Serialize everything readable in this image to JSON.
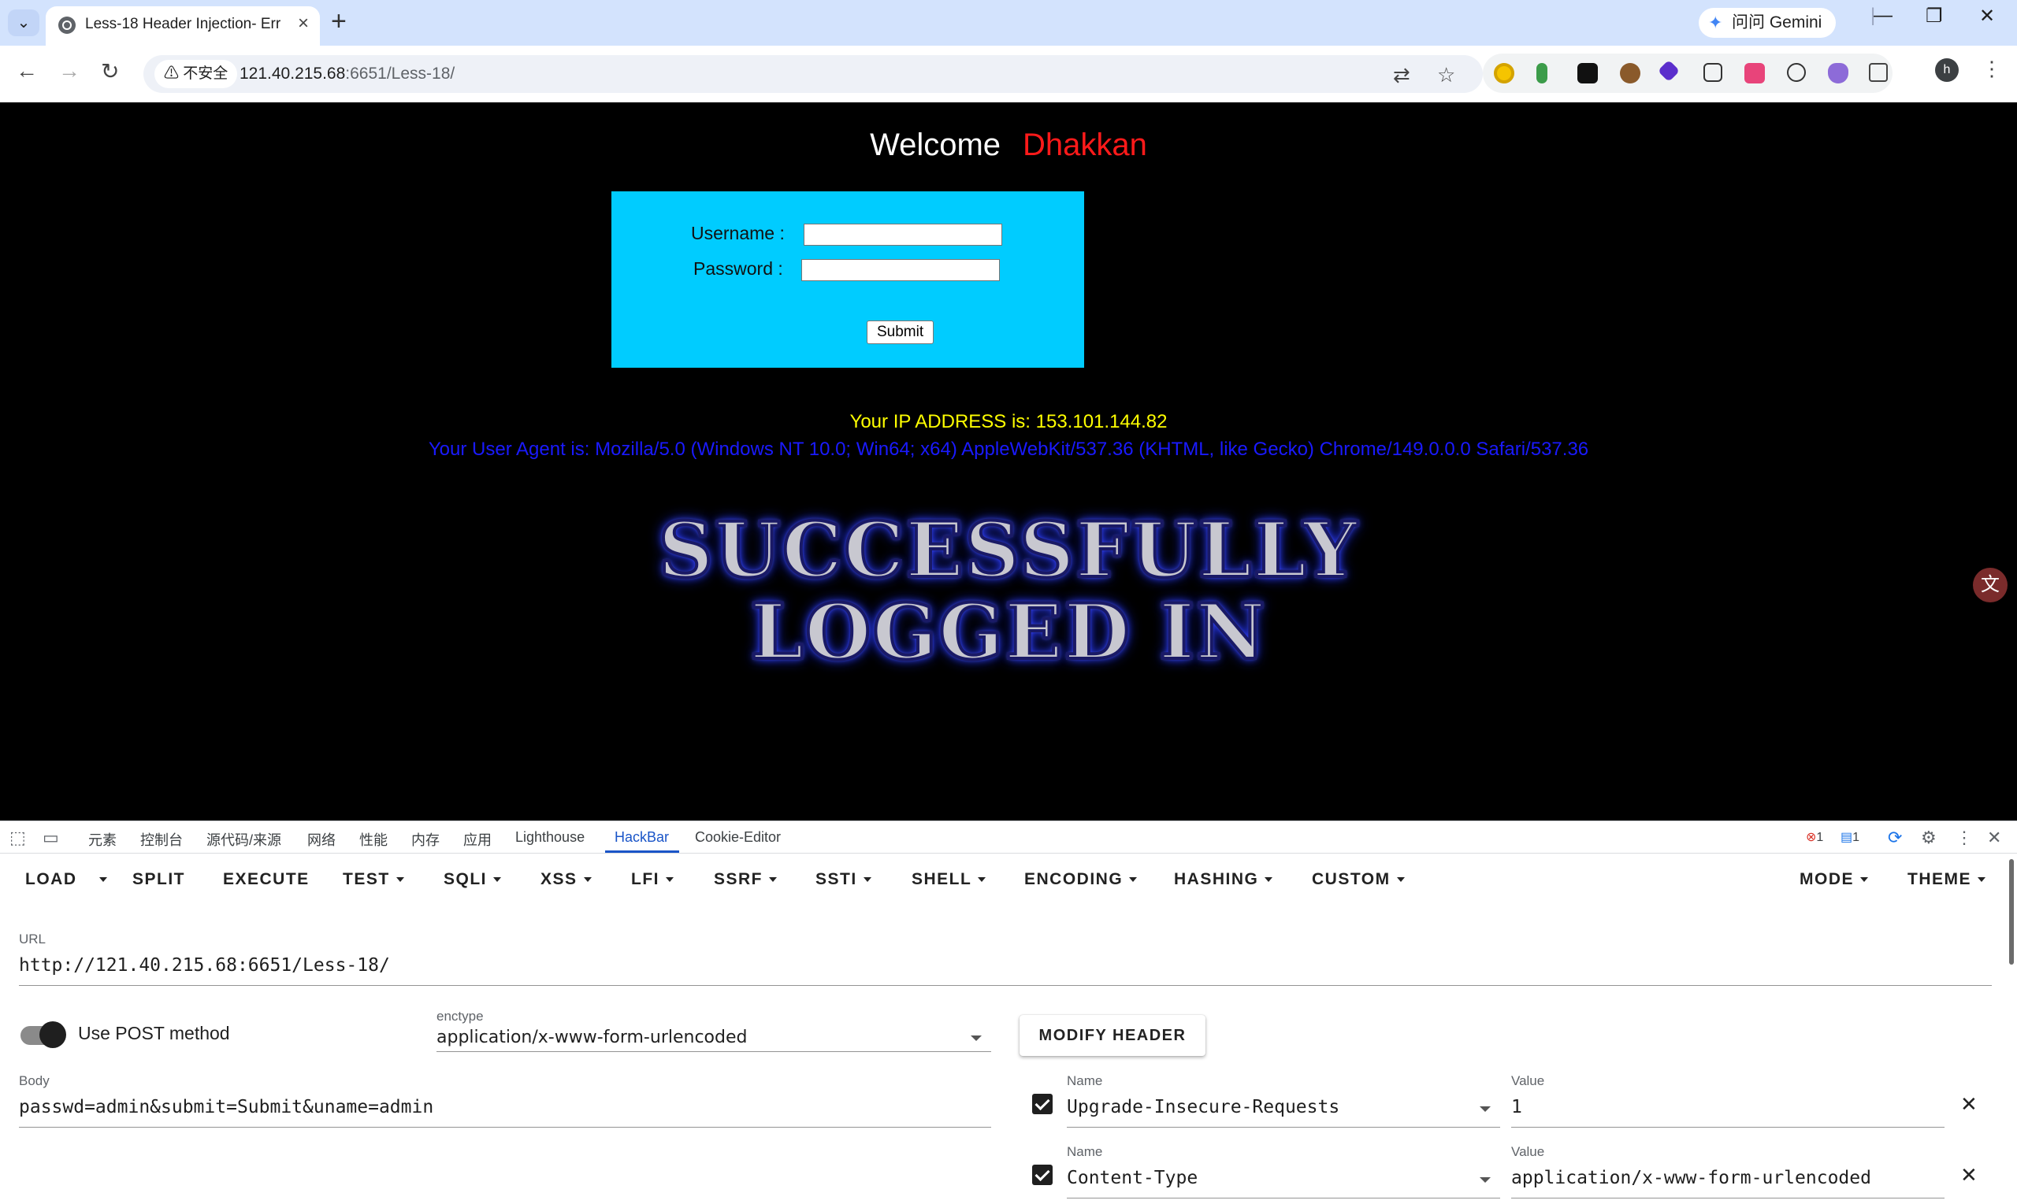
{
  "browser": {
    "tab_title": "Less-18 Header Injection- Err",
    "new_tab": "+",
    "gemini_label": "问问 Gemini",
    "insecure_label": "不安全",
    "url_host": "121.40.215.68",
    "url_rest": ":6651/Less-18/",
    "profile_initial": "h"
  },
  "page": {
    "welcome": "Welcome",
    "user": "Dhakkan",
    "username_label": "Username :",
    "password_label": "Password :",
    "submit_label": "Submit",
    "ip_line": "Your IP ADDRESS is: 153.101.144.82",
    "ua_line": "Your User Agent is: Mozilla/5.0 (Windows NT 10.0; Win64; x64) AppleWebKit/537.36 (KHTML, like Gecko) Chrome/149.0.0.0 Safari/537.36",
    "success_line1": "SUCCESSFULLY",
    "success_line2": "LOGGED IN"
  },
  "devtools": {
    "tabs": [
      "元素",
      "控制台",
      "源代码/来源",
      "网络",
      "性能",
      "内存",
      "应用",
      "Lighthouse",
      "HackBar",
      "Cookie-Editor"
    ],
    "active_tab": "HackBar",
    "error_count": "1",
    "message_count": "1"
  },
  "hackbar": {
    "menu": {
      "load": "LOAD",
      "split": "SPLIT",
      "execute": "EXECUTE",
      "test": "TEST",
      "sqli": "SQLI",
      "xss": "XSS",
      "lfi": "LFI",
      "ssrf": "SSRF",
      "ssti": "SSTI",
      "shell": "SHELL",
      "encoding": "ENCODING",
      "hashing": "HASHING",
      "custom": "CUSTOM",
      "mode": "MODE",
      "theme": "THEME"
    },
    "url_label": "URL",
    "url_value": "http://121.40.215.68:6651/Less-18/",
    "post_toggle_label": "Use POST method",
    "post_enabled": true,
    "enctype_label": "enctype",
    "enctype_value": "application/x-www-form-urlencoded",
    "modify_header": "MODIFY HEADER",
    "body_label": "Body",
    "body_value": "passwd=admin&submit=Submit&uname=admin",
    "headers": [
      {
        "name_label": "Name",
        "name": "Upgrade-Insecure-Requests",
        "value_label": "Value",
        "value": "1",
        "enabled": true
      },
      {
        "name_label": "Name",
        "name": "Content-Type",
        "value_label": "Value",
        "value": "application/x-www-form-urlencoded",
        "enabled": true
      }
    ]
  },
  "colors": {
    "welcome_user": "#ff1a1a",
    "login_box": "#00ccff",
    "ip_text": "#ffff00",
    "ua_text": "#1a1aff",
    "hackbar_active": "#1a55c8"
  }
}
